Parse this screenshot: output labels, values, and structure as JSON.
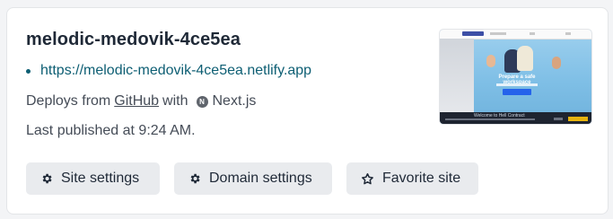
{
  "site": {
    "name": "melodic-medovik-4ce5ea",
    "url": "https://melodic-medovik-4ce5ea.netlify.app",
    "deploy": {
      "prefix": "Deploys from",
      "source": "GitHub",
      "with": "with",
      "framework": "Next.js",
      "framework_icon": "nextjs-icon"
    },
    "last_published": "Last published at 9:24 AM."
  },
  "actions": {
    "site_settings": "Site settings",
    "domain_settings": "Domain settings",
    "favorite": "Favorite site"
  },
  "thumbnail": {
    "headline": "Prepare a safe workspace",
    "welcome": "Welcome to Hell Contract"
  },
  "colors": {
    "link": "#0d5e73",
    "title": "#1f2937",
    "button_bg": "#e9ebee",
    "text_muted": "#454c57"
  }
}
